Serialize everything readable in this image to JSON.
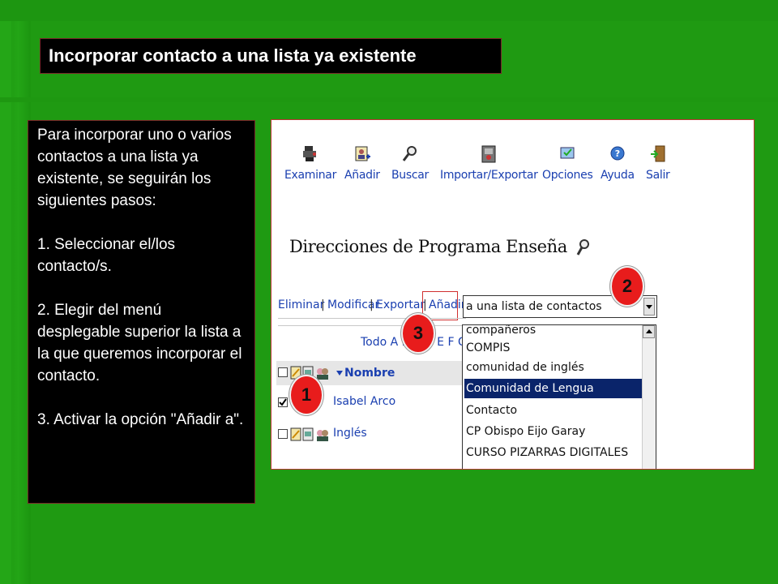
{
  "slide": {
    "title": "Incorporar contacto a una lista ya existente",
    "instructions": {
      "intro": "Para incorporar uno o varios contactos a una lista ya existente, se seguirán los siguientes pasos:",
      "step1": "1. Seleccionar el/los contacto/s.",
      "step2": "2. Elegir del menú desplegable superior la lista a la que queremos incorporar el contacto.",
      "step3": "3. Activar la opción \"Añadir a\"."
    }
  },
  "app": {
    "toolbar": [
      {
        "label": "Examinar",
        "icon": "examine-icon"
      },
      {
        "label": "Añadir",
        "icon": "add-icon"
      },
      {
        "label": "Buscar",
        "icon": "search-icon"
      },
      {
        "label": "Importar/Exportar",
        "icon": "import-export-icon"
      },
      {
        "label": "Opciones",
        "icon": "options-icon"
      },
      {
        "label": "Ayuda",
        "icon": "help-icon"
      },
      {
        "label": "Salir",
        "icon": "exit-icon"
      }
    ],
    "page_title": "Direcciones de Programa Enseña",
    "actions": {
      "eliminar": "Eliminar",
      "modificar": "Modificar",
      "exportar": "Exportar",
      "anadir": "Añadir",
      "separator": "|"
    },
    "select_value": "a una lista de contactos",
    "letters": "Todo A B C D E F G H",
    "list_header": "Nombre",
    "rows": [
      {
        "name": "Isabel Arco",
        "checked": true
      },
      {
        "name": "Inglés",
        "checked": false
      }
    ],
    "dropdown_options": [
      {
        "label": "compañeros",
        "selected": false
      },
      {
        "label": "COMPIS",
        "selected": false
      },
      {
        "label": "comunidad de inglés",
        "selected": false
      },
      {
        "label": "Comunidad de Lengua",
        "selected": true
      },
      {
        "label": "Contacto",
        "selected": false
      },
      {
        "label": "CP Obispo Eijo Garay",
        "selected": false
      },
      {
        "label": "CURSO PIZARRAS DIGITALES",
        "selected": false
      }
    ],
    "markers": [
      "1",
      "2",
      "3"
    ]
  },
  "colors": {
    "background": "#1f9a12",
    "box": "#000000",
    "link": "#1a3fb0",
    "selected": "#0a246a",
    "marker": "#e81c1c"
  }
}
